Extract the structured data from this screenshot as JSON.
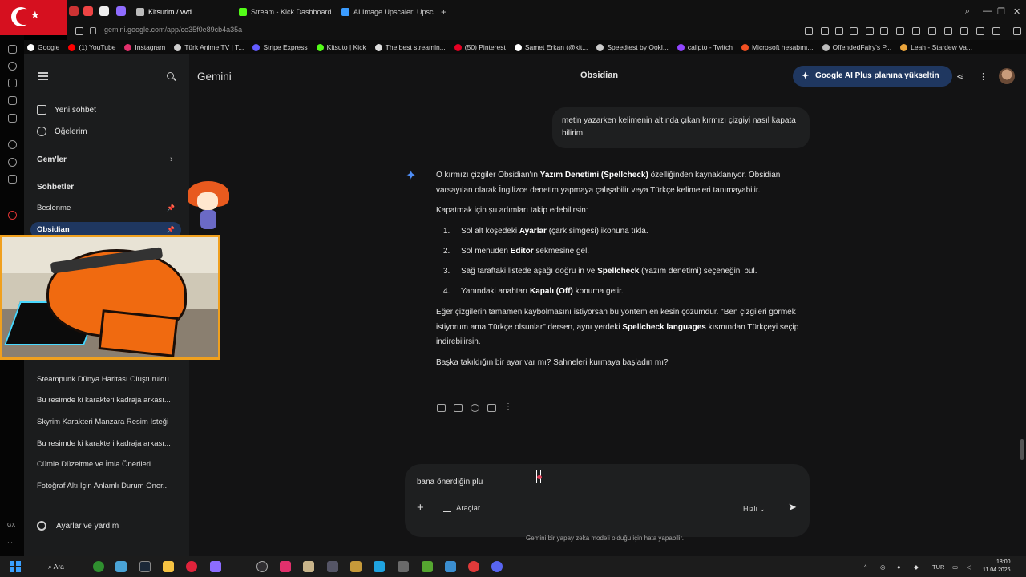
{
  "browser": {
    "tabs": [
      {
        "label": "Kitsurim / vvd"
      },
      {
        "label": "Stream - Kick Dashboard"
      },
      {
        "label": "AI Image Upscaler: Upsca"
      }
    ],
    "url": "gemini.google.com/app/ce35f0e89cb4a35a",
    "bookmarks": [
      {
        "label": "Google",
        "color": "#ffffff"
      },
      {
        "label": "(1) YouTube",
        "color": "#ff0000"
      },
      {
        "label": "Instagram",
        "color": "#e1306c"
      },
      {
        "label": "Türk Anime TV | T...",
        "color": "#cccccc"
      },
      {
        "label": "Stripe Express",
        "color": "#635bff"
      },
      {
        "label": "Kitsuto | Kick",
        "color": "#53fc18"
      },
      {
        "label": "The best streamin...",
        "color": "#dddddd"
      },
      {
        "label": "(50) Pinterest",
        "color": "#e60023"
      },
      {
        "label": "Samet Erkan (@kit...",
        "color": "#ffffff"
      },
      {
        "label": "Speedtest by Ookl...",
        "color": "#cccccc"
      },
      {
        "label": "calipto - Twitch",
        "color": "#9146ff"
      },
      {
        "label": "Microsoft hesabını...",
        "color": "#f25022"
      },
      {
        "label": "OffendedFairy's P...",
        "color": "#bbbbbb"
      },
      {
        "label": "Leah - Stardew Va...",
        "color": "#e8a33b"
      }
    ]
  },
  "sidebar": {
    "new_chat": "Yeni sohbet",
    "items": "Öğelerim",
    "gems": "Gem'ler",
    "chats_heading": "Sohbetler",
    "chats": [
      {
        "label": "Beslenme",
        "pinned": true
      },
      {
        "label": "Obsidian",
        "pinned": true,
        "active": true
      },
      {
        "label": "Steampunk Dünya Haritası Oluşturuldu"
      },
      {
        "label": "Bu resimde ki karakteri kadraja arkası..."
      },
      {
        "label": "Skyrim Karakteri Manzara Resim İsteği"
      },
      {
        "label": "Bu resimde ki karakteri kadraja arkası..."
      },
      {
        "label": "Cümle Düzeltme ve İmla Önerileri"
      },
      {
        "label": "Fotoğraf Altı İçin Anlamlı Durum Öner..."
      }
    ],
    "settings": "Ayarlar ve yardım"
  },
  "header": {
    "brand": "Gemini",
    "title": "Obsidian",
    "upgrade": "Google AI Plus planına yükseltin"
  },
  "user_message": "metin yazarken kelimenin altında çıkan kırmızı çizgiyi nasıl kapata bilirim",
  "answer": {
    "p1_a": "O kırmızı çizgiler Obsidian'ın ",
    "p1_b": "Yazım Denetimi (Spellcheck)",
    "p1_c": " özelliğinden kaynaklanıyor. Obsidian varsayılan olarak İngilizce denetim yapmaya çalışabilir veya Türkçe kelimeleri tanımayabilir.",
    "p2": "Kapatmak için şu adımları takip edebilirsin:",
    "steps": [
      {
        "n": "1.",
        "a": "Sol alt köşedeki ",
        "b": "Ayarlar",
        "c": " (çark simgesi) ikonuna tıkla."
      },
      {
        "n": "2.",
        "a": "Sol menüden ",
        "b": "Editor",
        "c": " sekmesine gel."
      },
      {
        "n": "3.",
        "a": "Sağ taraftaki listede aşağı doğru in ve ",
        "b": "Spellcheck",
        "c": " (Yazım denetimi) seçeneğini bul."
      },
      {
        "n": "4.",
        "a": "Yanındaki anahtarı ",
        "b": "Kapalı (Off)",
        "c": " konuma getir."
      }
    ],
    "p3_a": "Eğer çizgilerin tamamen kaybolmasını istiyorsan bu yöntem en kesin çözümdür. \"Ben çizgileri görmek istiyorum ama Türkçe olsunlar\" dersen, aynı yerdeki ",
    "p3_b": "Spellcheck languages",
    "p3_c": " kısmından Türkçeyi seçip indirebilirsin.",
    "p4": "Başka takıldığın bir ayar var mı? Sahneleri kurmaya başladın mı?"
  },
  "composer": {
    "text": "bana önerdiğin plu",
    "tools": "Araçlar",
    "speed": "Hızlı"
  },
  "disclaimer": "Gemini bir yapay zeka modeli olduğu için hata yapabilir.",
  "taskbar": {
    "search": "Ara",
    "lang": "TUR",
    "time": "18:00",
    "date": "11.04.2026"
  },
  "gx_label": "GX",
  "colors": {
    "accent": "#1f3760",
    "gemini_blue": "#4f8ef7",
    "overlay_border": "#f0a01e"
  }
}
